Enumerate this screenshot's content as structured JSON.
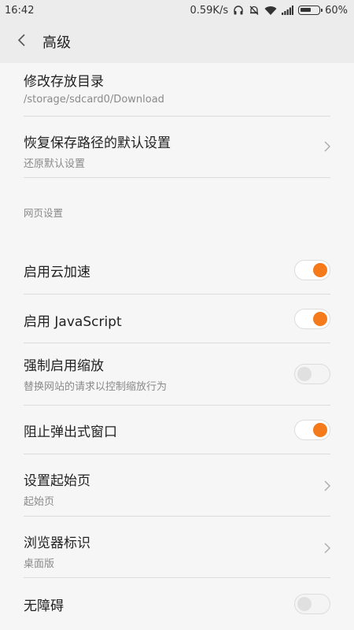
{
  "status_bar": {
    "time": "16:42",
    "net_speed": "0.59K/s",
    "battery_percent": "60%",
    "battery_level": 0.6,
    "icons": [
      "headphones-icon",
      "alarm-off-icon",
      "wifi-icon",
      "signal-icon",
      "battery-icon"
    ]
  },
  "header": {
    "title": "高级",
    "back_icon": "chevron-left-icon"
  },
  "download": {
    "title": "修改存放目录",
    "path": "/storage/sdcard0/Download"
  },
  "restore": {
    "title": "恢复保存路径的默认设置",
    "subtitle": "还原默认设置"
  },
  "web_section": {
    "label": "网页设置"
  },
  "web_items": [
    {
      "title": "启用云加速",
      "toggle": "on"
    },
    {
      "title": "启用 JavaScript",
      "toggle": "on"
    },
    {
      "title": "强制启用缩放",
      "subtitle": "替换网站的请求以控制缩放行为",
      "toggle": "off"
    },
    {
      "title": "阻止弹出式窗口",
      "toggle": "on"
    },
    {
      "title": "设置起始页",
      "subtitle": "起始页"
    },
    {
      "title": "浏览器标识",
      "subtitle": "桌面版"
    },
    {
      "title": "无障碍",
      "toggle": "off"
    }
  ],
  "colors": {
    "accent": "#f57a1c",
    "header_bg": "#ececec",
    "page_bg": "#f6f6f6"
  }
}
